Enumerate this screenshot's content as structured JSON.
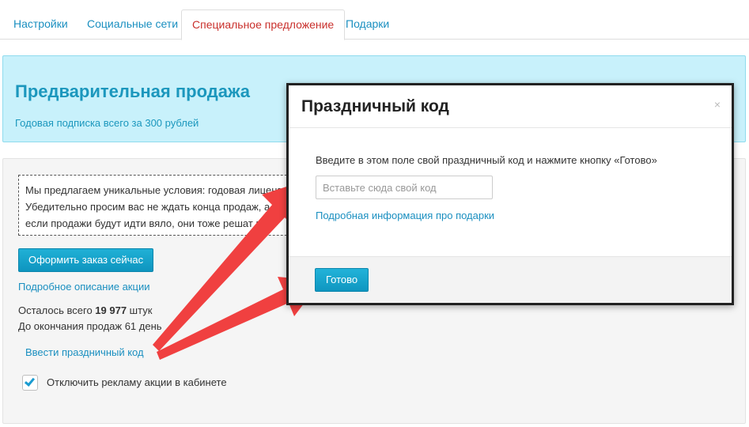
{
  "tabs": [
    {
      "label": "Настройки",
      "active": false
    },
    {
      "label": "Социальные сети",
      "active": false
    },
    {
      "label": "Специальное предложение",
      "active": true
    },
    {
      "label": "Подарки",
      "active": false
    }
  ],
  "hero": {
    "title": "Предварительная продажа",
    "subtitle": "Годовая подписка всего за 300 рублей"
  },
  "offer": {
    "lines": [
      "Мы предлагаем уникальные условия: годовая лицензи",
      "Убедительно просим вас не ждать конца продаж, а оф",
      "если продажи будут идти вяло, они тоже решат по"
    ],
    "order_button": "Оформить заказ сейчас",
    "details_link": "Подробное описание акции",
    "remaining_prefix": "Осталось всего ",
    "remaining_count": "19 977",
    "remaining_suffix": " штук",
    "days_left": "До окончания продаж 61 день",
    "holiday_code_link": "Ввести праздничный код",
    "disable_ads_label": "Отключить рекламу акции в кабинете",
    "disable_ads_checked": true
  },
  "modal": {
    "title": "Праздничный код",
    "close": "×",
    "instruction": "Введите в этом поле свой праздничный код и нажмите кнопку «Готово»",
    "input_placeholder": "Вставьте сюда свой код",
    "input_value": "",
    "info_link": "Подробная информация про подарки",
    "done_button": "Готово"
  },
  "colors": {
    "link": "#1a8fc0",
    "active_tab": "#c9302c",
    "hero_bg": "#c8f1fb",
    "button": "#0e95bf",
    "arrow": "#f04040"
  }
}
